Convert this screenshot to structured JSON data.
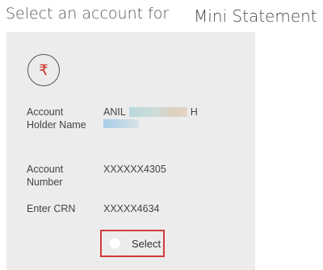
{
  "header": {
    "title_prefix": "Select an account for",
    "title_section": "Mini Statement"
  },
  "account_card": {
    "currency_icon": "rupee-icon",
    "currency_symbol": "₹",
    "accent_color": "#d0312d",
    "holder": {
      "label": "Account Holder Name",
      "value_start": "ANIL",
      "value_end": "H"
    },
    "account_number": {
      "label": "Account Number",
      "value": "XXXXXX4305"
    },
    "crn": {
      "label": "Enter CRN",
      "value": "XXXXX4634"
    },
    "select": {
      "label": "Select",
      "checked": false,
      "highlight_color": "#d23c3c"
    }
  }
}
